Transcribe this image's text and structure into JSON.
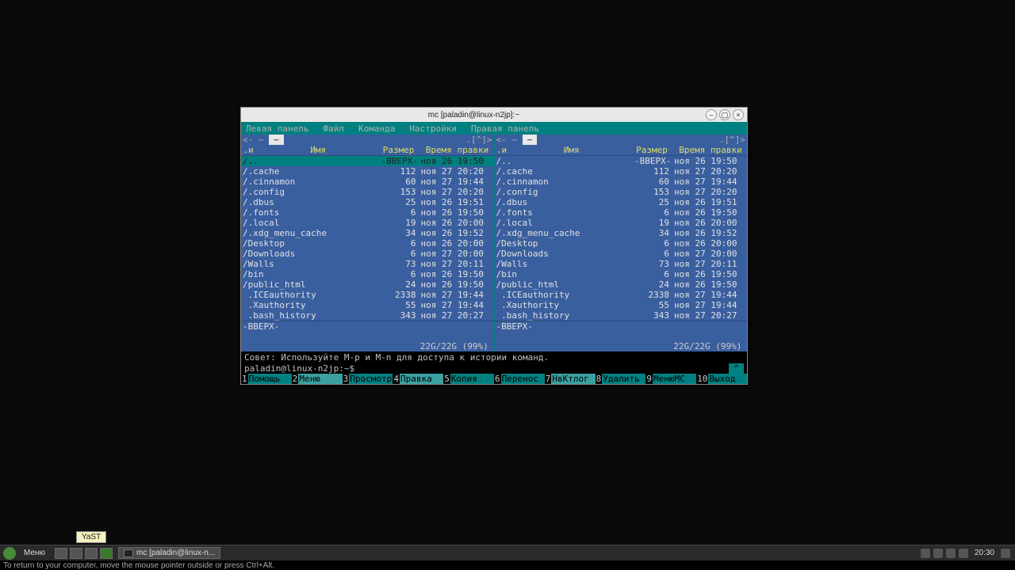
{
  "window": {
    "title": "mc [paladin@linux-n2jp]:~"
  },
  "menubar": [
    "Левая панель",
    "Файл",
    "Команда",
    "Настройки",
    "Правая панель"
  ],
  "panel_top": {
    "left": "<- ~",
    "right": ".[^]>"
  },
  "panel_header": {
    "n": ".и",
    "name": "Имя",
    "size": "Размер",
    "date": "Время правки"
  },
  "files": [
    {
      "name": "/..",
      "size": "-ВВЕРХ-",
      "date": "ноя 26 19:50",
      "sel": true
    },
    {
      "name": "/.cache",
      "size": "112",
      "date": "ноя 27 20:20"
    },
    {
      "name": "/.cinnamon",
      "size": "60",
      "date": "ноя 27 19:44"
    },
    {
      "name": "/.config",
      "size": "153",
      "date": "ноя 27 20:20"
    },
    {
      "name": "/.dbus",
      "size": "25",
      "date": "ноя 26 19:51"
    },
    {
      "name": "/.fonts",
      "size": "6",
      "date": "ноя 26 19:50"
    },
    {
      "name": "/.local",
      "size": "19",
      "date": "ноя 26 20:00"
    },
    {
      "name": "/.xdg_menu_cache",
      "size": "34",
      "date": "ноя 26 19:52"
    },
    {
      "name": "/Desktop",
      "size": "6",
      "date": "ноя 26 20:00"
    },
    {
      "name": "/Downloads",
      "size": "6",
      "date": "ноя 27 20:00"
    },
    {
      "name": "/Walls",
      "size": "73",
      "date": "ноя 27 20:11"
    },
    {
      "name": "/bin",
      "size": "6",
      "date": "ноя 26 19:50"
    },
    {
      "name": "/public_html",
      "size": "24",
      "date": "ноя 26 19:50"
    },
    {
      "name": " .ICEauthority",
      "size": "2338",
      "date": "ноя 27 19:44"
    },
    {
      "name": " .Xauthority",
      "size": "55",
      "date": "ноя 27 19:44"
    },
    {
      "name": " .bash_history",
      "size": "343",
      "date": "ноя 27 20:27"
    }
  ],
  "panel_foot": "-ВВЕРХ-",
  "disk_usage": "22G/22G (99%)",
  "hint": "Совет: Используйте M-p и M-n для доступа к истории команд.",
  "prompt": "paladin@linux-n2jp:~$",
  "prompt_clock": "^",
  "fkeys": [
    {
      "n": "1",
      "l": "Помощь"
    },
    {
      "n": "2",
      "l": "Меню",
      "hl": true
    },
    {
      "n": "3",
      "l": "Просмотр"
    },
    {
      "n": "4",
      "l": "Правка",
      "hl": true
    },
    {
      "n": "5",
      "l": "Копия"
    },
    {
      "n": "6",
      "l": "Перенос"
    },
    {
      "n": "7",
      "l": "НвКтлог",
      "hl": true
    },
    {
      "n": "8",
      "l": "Удалить"
    },
    {
      "n": "9",
      "l": "МенюMC"
    },
    {
      "n": "10",
      "l": "Выход"
    }
  ],
  "taskbar": {
    "menu_label": "Меню",
    "task_label": "mc [paladin@linux-n...",
    "clock": "20:30",
    "tooltip": "YaST"
  },
  "statusline": "To return to your computer, move the mouse pointer outside or press Ctrl+Alt."
}
